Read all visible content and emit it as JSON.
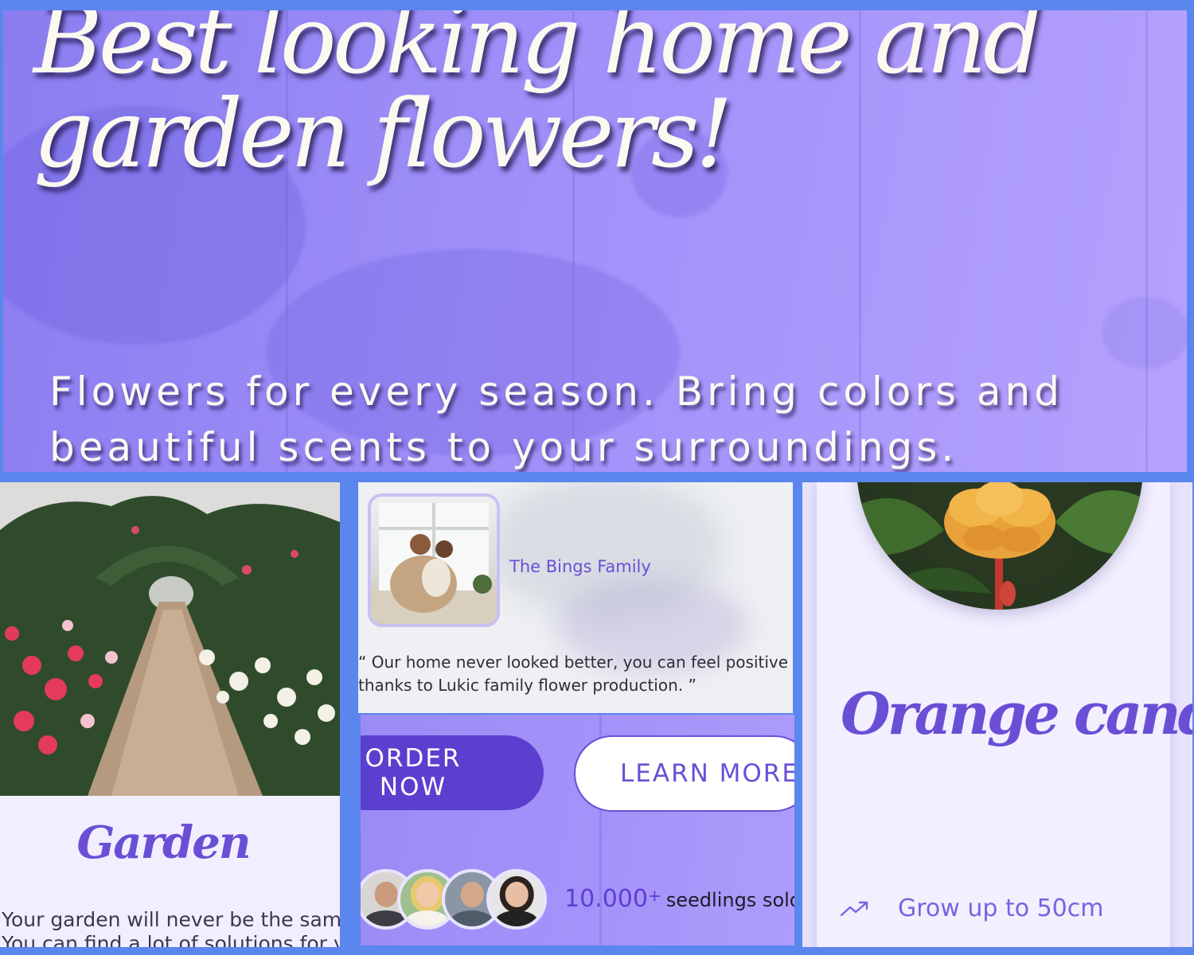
{
  "hero": {
    "title": "Best looking home and garden flowers!",
    "subtitle": "Flowers for every season. Bring colors and beautiful scents to your surroundings."
  },
  "garden": {
    "title": "Garden",
    "text_line1": "Your garden will never be the same!",
    "text_line2": "You can find a lot of solutions for your"
  },
  "testimonial": {
    "name": "The Bings Family",
    "quote_line1": "“ Our home never looked better, you can feel positive energy",
    "quote_line2": "thanks to Lukic family flower production. ”"
  },
  "cta": {
    "order_label": "ORDER NOW",
    "learn_label": "LEARN MORE",
    "sold_number": "10.000",
    "sold_plus": "+",
    "sold_text": "seedlings sold last"
  },
  "product": {
    "name": "Orange candy",
    "feature": "Grow up to 50cm",
    "feature_icon": "trending-up-icon"
  },
  "colors": {
    "frame": "#5b86ee",
    "accent": "#6a4fd6",
    "button": "#5b3fcf",
    "panel": "#f1efff"
  }
}
